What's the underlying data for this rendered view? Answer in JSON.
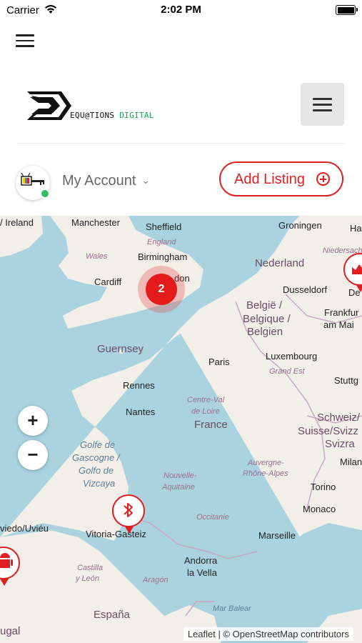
{
  "status_bar": {
    "carrier": "Carrier",
    "time": "2:02 PM"
  },
  "header": {
    "brand_text": "EQU@TIONS",
    "brand_suffix": "DIGITAL"
  },
  "account": {
    "label": "My Account",
    "add_listing_label": "Add Listing"
  },
  "map": {
    "cluster_count": "2",
    "labels": {
      "ireland": "/ Ireland",
      "manchester": "Manchester",
      "sheffield": "Sheffield",
      "england": "England",
      "wales": "Wales",
      "birmingham": "Birmingham",
      "cardiff": "Cardiff",
      "london": "don",
      "groningen": "Groningen",
      "ha": "Ha",
      "niedersachsen": "Niedersach",
      "nederland": "Nederland",
      "dusseldorf": "Dusseldorf",
      "de": "De",
      "belgie": "België /",
      "belgique": "Belgique /",
      "belgien": "Belgien",
      "frankfurt": "Frankfur",
      "am_main": "am Mai",
      "guernsey": "Guernsey",
      "luxembourg": "Luxembourg",
      "paris": "Paris",
      "grand_est": "Grand Est",
      "stuttgart": "Stuttg",
      "rennes": "Rennes",
      "centre_val": "Centre-Val",
      "de_loire": "de Loire",
      "nantes": "Nantes",
      "france": "France",
      "schweiz": "Schweiz/",
      "suisse": "Suisse/Svizz",
      "svizra": "Svizra",
      "golfe": "Golfe de",
      "gascogne": "Gascogne /",
      "golfo": "Golfo de",
      "vizcaya": "Vizcaya",
      "milan": "Milan",
      "auvergne": "Auvergne-",
      "rhone": "Rhône-Alpes",
      "nouvelle": "Nouvelle-",
      "aquitaine": "Aquitaine",
      "torino": "Torino",
      "monaco": "Monaco",
      "occitanie": "Occitanie",
      "oviedo": "viedo/Uviéu",
      "vitoria": "Vitoria-Gasteiz",
      "marseille": "Marseille",
      "andorra": "Andorra",
      "la_vella": "la Vella",
      "castilla": "Castilla",
      "y_leon": "y León",
      "aragon": "Aragón",
      "mar_balear": "Mar Balear",
      "espana": "España",
      "portugal": "ugal"
    },
    "attribution": {
      "leaflet": "Leaflet",
      "separator": " | © ",
      "osm": "OpenStreetMap",
      "contributors": " contributors"
    },
    "colors": {
      "land": "#f2efe9",
      "water": "#aad3df",
      "accent": "#e02020"
    },
    "icons": {
      "bluetooth_pin": "bluetooth-icon",
      "android_pin": "android-icon",
      "chart_pin": "chart-icon"
    }
  }
}
